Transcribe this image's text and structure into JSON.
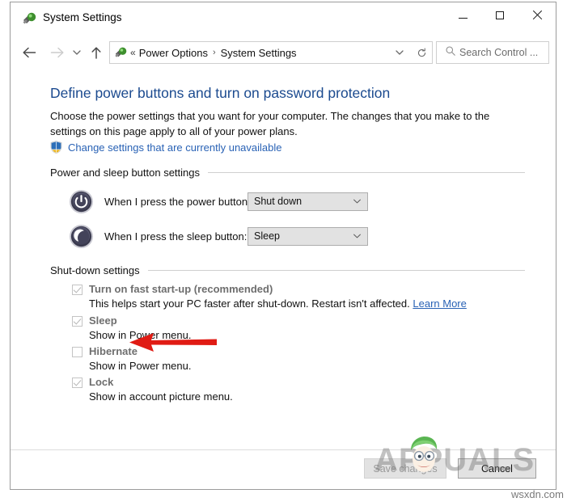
{
  "window": {
    "title": "System Settings",
    "icon": "power-options-icon",
    "controls": {
      "minimize": "Minimize",
      "maximize": "Maximize",
      "close": "Close"
    }
  },
  "navbar": {
    "back": "Back",
    "forward": "Forward",
    "recent": "Recent locations",
    "up": "Up one level",
    "address": {
      "icon": "power-options-icon",
      "prefix": "«",
      "crumbs": [
        "Power Options",
        "System Settings"
      ],
      "separator": "›",
      "chevron": "chevron-down-icon"
    },
    "refresh": "Refresh",
    "search": {
      "placeholder": "Search Control ...",
      "icon": "search-icon"
    }
  },
  "content": {
    "page_title": "Define power buttons and turn on password protection",
    "page_description": "Choose the power settings that you want for your computer. The changes that you make to the settings on this page apply to all of your power plans.",
    "uac_link": "Change settings that are currently unavailable",
    "sections": {
      "power_sleep": {
        "header": "Power and sleep button settings",
        "rows": [
          {
            "icon": "power-button-icon",
            "label": "When I press the power button:",
            "value": "Shut down"
          },
          {
            "icon": "sleep-button-icon",
            "label": "When I press the sleep button:",
            "value": "Sleep"
          }
        ]
      },
      "shutdown": {
        "header": "Shut-down settings",
        "items": [
          {
            "title": "Turn on fast start-up (recommended)",
            "checked": true,
            "disabled": true,
            "sub": "This helps start your PC faster after shut-down. Restart isn't affected.",
            "link": "Learn More"
          },
          {
            "title": "Sleep",
            "checked": true,
            "disabled": true,
            "sub": "Show in Power menu.",
            "link": ""
          },
          {
            "title": "Hibernate",
            "checked": false,
            "disabled": true,
            "sub": "Show in Power menu.",
            "link": ""
          },
          {
            "title": "Lock",
            "checked": true,
            "disabled": true,
            "sub": "Show in account picture menu.",
            "link": ""
          }
        ]
      }
    },
    "annotation": {
      "type": "red-arrow",
      "points_to": "Hibernate",
      "color": "#e01b14"
    }
  },
  "footer": {
    "save_label": "Save changes",
    "save_disabled": true,
    "cancel_label": "Cancel"
  },
  "watermarks": {
    "brand": "APPUALS",
    "site": "wsxdn.com"
  },
  "colors": {
    "title_blue": "#1b4a8f",
    "link_blue": "#2962b5",
    "arrow_red": "#e01b14",
    "combo_bg": "#e2e2e2",
    "window_border": "#9b9b9b"
  }
}
